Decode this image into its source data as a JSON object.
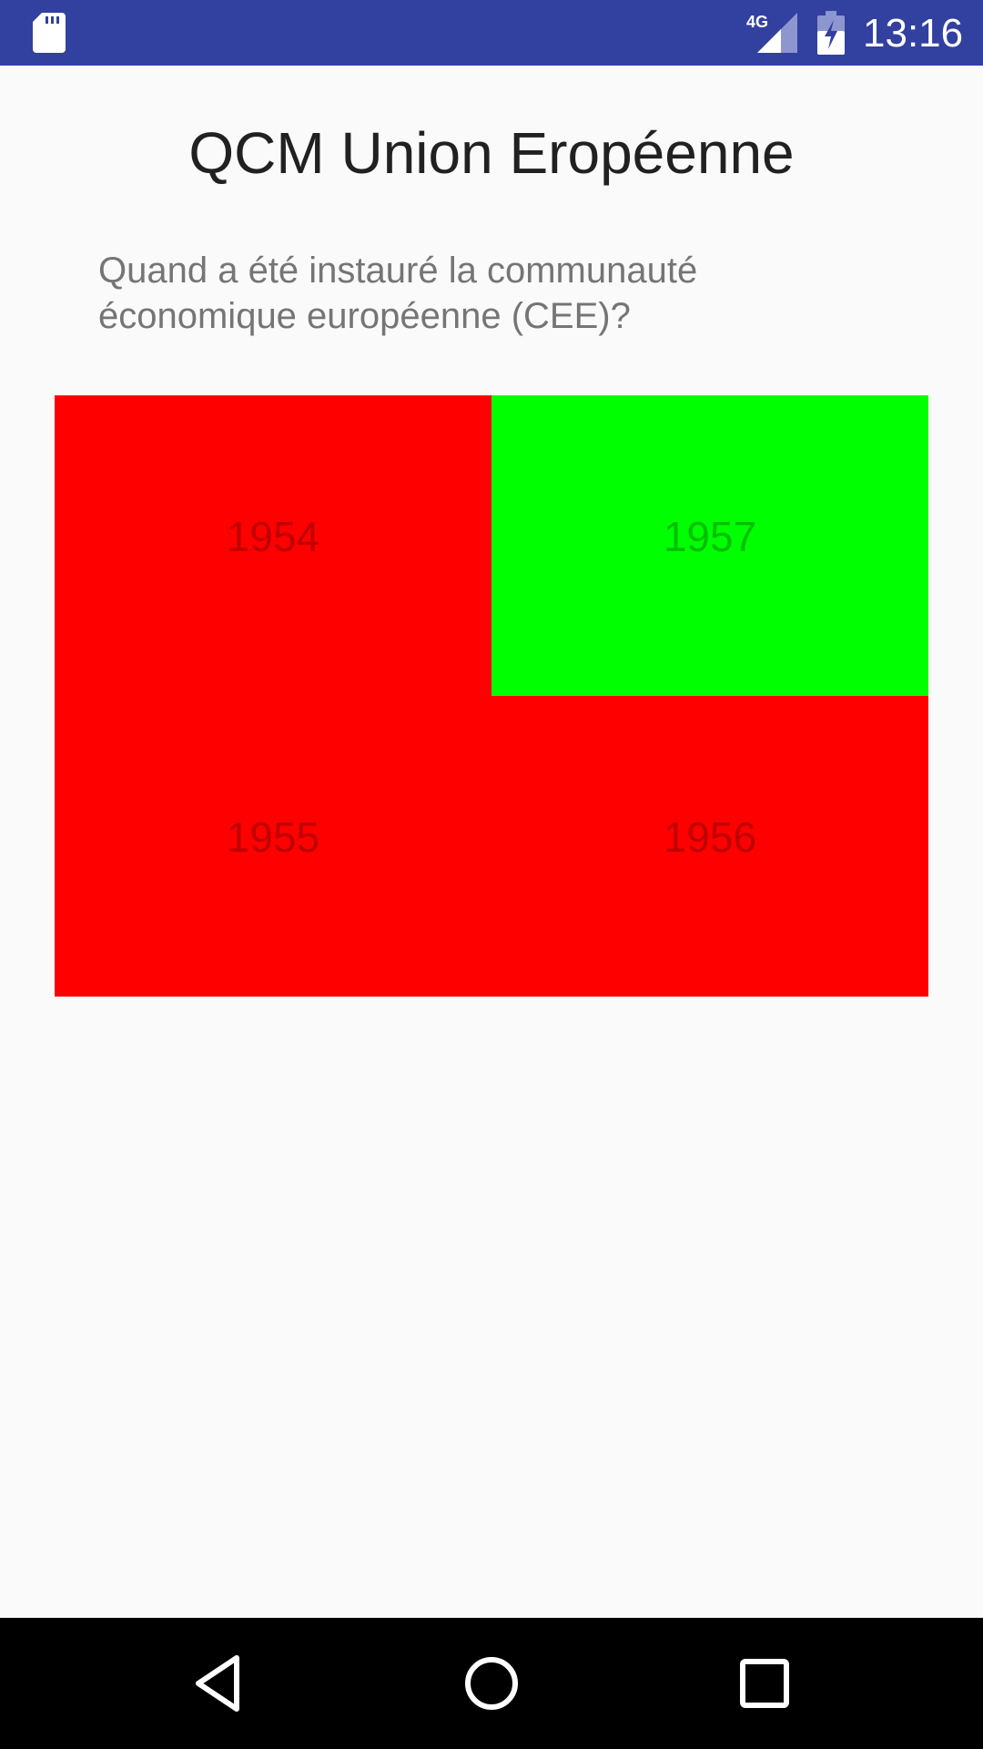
{
  "status_bar": {
    "time": "13:16",
    "network": "4G",
    "background_color": "#3240a0",
    "icons": [
      "sd-card-icon",
      "signal-icon",
      "battery-charging-icon"
    ]
  },
  "app": {
    "title": "QCM Union Eropéenne"
  },
  "quiz": {
    "question": "Quand a été instauré la communauté économique européenne (CEE)?",
    "answers": [
      {
        "label": "1954",
        "color": "#ff0000",
        "state": "wrong"
      },
      {
        "label": "1957",
        "color": "#00ff00",
        "state": "correct"
      },
      {
        "label": "1955",
        "color": "#ff0000",
        "state": "wrong"
      },
      {
        "label": "1956",
        "color": "#ff0000",
        "state": "wrong"
      }
    ]
  },
  "nav_bar": {
    "icons": [
      "back-icon",
      "home-icon",
      "recents-icon"
    ]
  }
}
